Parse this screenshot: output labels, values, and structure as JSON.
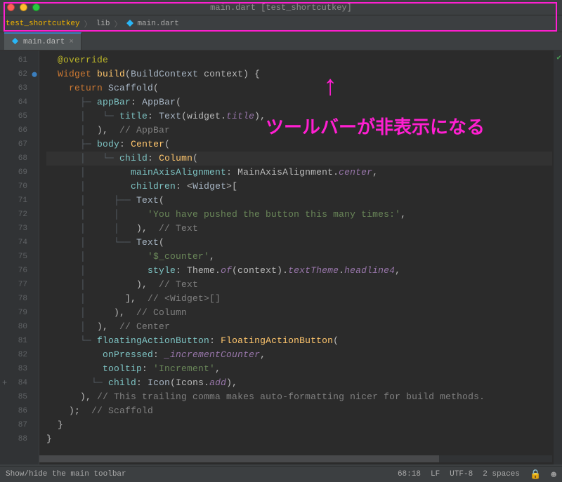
{
  "window": {
    "title": "main.dart [test_shortcutkey]"
  },
  "breadcrumbs": {
    "item0": "test_shortcutkey",
    "item1": "lib",
    "item2": "main.dart"
  },
  "tabs": {
    "active": {
      "label": "main.dart"
    }
  },
  "annotation": {
    "text": "ツールバーが非表示になる",
    "arrow": "↑"
  },
  "gutter": {
    "start": 61,
    "current": 68,
    "addMarkAt": 84
  },
  "code_lines": [
    {
      "n": 61,
      "seg": [
        [
          "  ",
          ""
        ],
        [
          "@override",
          "c-ann"
        ]
      ]
    },
    {
      "n": 62,
      "seg": [
        [
          "  ",
          ""
        ],
        [
          "Widget ",
          "c-kw"
        ],
        [
          "build",
          "c-meth"
        ],
        [
          "(",
          ""
        ],
        [
          "BuildContext",
          "c-type"
        ],
        [
          " context) {",
          ""
        ]
      ]
    },
    {
      "n": 63,
      "seg": [
        [
          "    ",
          ""
        ],
        [
          "return ",
          "c-kw"
        ],
        [
          "Scaffold",
          "c-type"
        ],
        [
          "(",
          ""
        ]
      ]
    },
    {
      "n": 64,
      "seg": [
        [
          "      ",
          ""
        ],
        [
          "├─ ",
          "tree"
        ],
        [
          "appBar",
          "c-named"
        ],
        [
          ": ",
          ""
        ],
        [
          "AppBar",
          "c-type"
        ],
        [
          "(",
          ""
        ]
      ]
    },
    {
      "n": 65,
      "seg": [
        [
          "      ",
          ""
        ],
        [
          "│   └─ ",
          "tree"
        ],
        [
          "title",
          "c-named"
        ],
        [
          ": ",
          ""
        ],
        [
          "Text",
          "c-type"
        ],
        [
          "(widget.",
          ""
        ],
        [
          "title",
          "c-id"
        ],
        [
          "),",
          ""
        ]
      ]
    },
    {
      "n": 66,
      "seg": [
        [
          "      ",
          ""
        ],
        [
          "│  ",
          "tree"
        ],
        [
          "),  ",
          ""
        ],
        [
          "// AppBar",
          "c-cmt"
        ]
      ]
    },
    {
      "n": 67,
      "seg": [
        [
          "      ",
          ""
        ],
        [
          "├─ ",
          "tree"
        ],
        [
          "body",
          "c-named"
        ],
        [
          ": ",
          ""
        ],
        [
          "Center",
          "c-coly"
        ],
        [
          "(",
          ""
        ]
      ]
    },
    {
      "n": 68,
      "current": true,
      "seg": [
        [
          "      ",
          ""
        ],
        [
          "│   └─ ",
          "tree"
        ],
        [
          "child",
          "c-named"
        ],
        [
          ": ",
          ""
        ],
        [
          "Column",
          "c-coly"
        ],
        [
          "(",
          ""
        ]
      ]
    },
    {
      "n": 69,
      "seg": [
        [
          "      ",
          ""
        ],
        [
          "│        ",
          "tree"
        ],
        [
          "mainAxisAlignment",
          "c-named"
        ],
        [
          ": MainAxisAlignment.",
          ""
        ],
        [
          "center",
          "c-id"
        ],
        [
          ",",
          ""
        ]
      ]
    },
    {
      "n": 70,
      "seg": [
        [
          "      ",
          ""
        ],
        [
          "│        ",
          "tree"
        ],
        [
          "children",
          "c-named"
        ],
        [
          ": <",
          ""
        ],
        [
          "Widget",
          "c-type"
        ],
        [
          ">[",
          ""
        ]
      ]
    },
    {
      "n": 71,
      "seg": [
        [
          "      ",
          ""
        ],
        [
          "│     ├── ",
          "tree"
        ],
        [
          "Text",
          "c-type"
        ],
        [
          "(",
          ""
        ]
      ]
    },
    {
      "n": 72,
      "seg": [
        [
          "      ",
          ""
        ],
        [
          "│     │     ",
          "tree"
        ],
        [
          "'You have pushed the button this many times:'",
          "c-str"
        ],
        [
          ",",
          ""
        ]
      ]
    },
    {
      "n": 73,
      "seg": [
        [
          "      ",
          ""
        ],
        [
          "│     │   ",
          "tree"
        ],
        [
          "),  ",
          ""
        ],
        [
          "// Text",
          "c-cmt"
        ]
      ]
    },
    {
      "n": 74,
      "seg": [
        [
          "      ",
          ""
        ],
        [
          "│     └── ",
          "tree"
        ],
        [
          "Text",
          "c-type"
        ],
        [
          "(",
          ""
        ]
      ]
    },
    {
      "n": 75,
      "seg": [
        [
          "      ",
          ""
        ],
        [
          "│           ",
          "tree"
        ],
        [
          "'$_counter'",
          "c-str"
        ],
        [
          ",",
          ""
        ]
      ]
    },
    {
      "n": 76,
      "seg": [
        [
          "      ",
          ""
        ],
        [
          "│           ",
          "tree"
        ],
        [
          "style",
          "c-named"
        ],
        [
          ": Theme.",
          ""
        ],
        [
          "of",
          "c-id"
        ],
        [
          "(context).",
          ""
        ],
        [
          "textTheme",
          "c-id"
        ],
        [
          ".",
          ""
        ],
        [
          "headline4",
          "c-id"
        ],
        [
          ",",
          ""
        ]
      ]
    },
    {
      "n": 77,
      "seg": [
        [
          "      ",
          ""
        ],
        [
          "│         ",
          "tree"
        ],
        [
          "),  ",
          ""
        ],
        [
          "// Text",
          "c-cmt"
        ]
      ]
    },
    {
      "n": 78,
      "seg": [
        [
          "      ",
          ""
        ],
        [
          "│       ",
          "tree"
        ],
        [
          "],  ",
          ""
        ],
        [
          "// <Widget>[]",
          "c-cmt"
        ]
      ]
    },
    {
      "n": 79,
      "seg": [
        [
          "      ",
          ""
        ],
        [
          "│     ",
          "tree"
        ],
        [
          "),  ",
          ""
        ],
        [
          "// Column",
          "c-cmt"
        ]
      ]
    },
    {
      "n": 80,
      "seg": [
        [
          "      ",
          ""
        ],
        [
          "│  ",
          "tree"
        ],
        [
          "),  ",
          ""
        ],
        [
          "// Center",
          "c-cmt"
        ]
      ]
    },
    {
      "n": 81,
      "seg": [
        [
          "      ",
          ""
        ],
        [
          "└─ ",
          "tree"
        ],
        [
          "floatingActionButton",
          "c-named"
        ],
        [
          ": ",
          ""
        ],
        [
          "FloatingActionButton",
          "c-coly"
        ],
        [
          "(",
          ""
        ]
      ]
    },
    {
      "n": 82,
      "seg": [
        [
          "          ",
          ""
        ],
        [
          "onPressed",
          "c-named"
        ],
        [
          ": ",
          ""
        ],
        [
          "_incrementCounter",
          "c-id"
        ],
        [
          ",",
          ""
        ]
      ]
    },
    {
      "n": 83,
      "seg": [
        [
          "          ",
          ""
        ],
        [
          "tooltip",
          "c-named"
        ],
        [
          ": ",
          ""
        ],
        [
          "'Increment'",
          "c-str"
        ],
        [
          ",",
          ""
        ]
      ]
    },
    {
      "n": 84,
      "seg": [
        [
          "        ",
          ""
        ],
        [
          "└─ ",
          "tree"
        ],
        [
          "child",
          "c-named"
        ],
        [
          ": ",
          ""
        ],
        [
          "Icon",
          "c-type"
        ],
        [
          "(Icons.",
          ""
        ],
        [
          "add",
          "c-id"
        ],
        [
          "),",
          ""
        ]
      ]
    },
    {
      "n": 85,
      "seg": [
        [
          "      ",
          ""
        ],
        [
          "), ",
          ""
        ],
        [
          "// This trailing comma makes auto-formatting nicer for build methods.",
          "c-cmt"
        ]
      ]
    },
    {
      "n": 86,
      "seg": [
        [
          "    ",
          ""
        ],
        [
          ");  ",
          ""
        ],
        [
          "// Scaffold",
          "c-cmt"
        ]
      ]
    },
    {
      "n": 87,
      "seg": [
        [
          "  }",
          ""
        ]
      ]
    },
    {
      "n": 88,
      "seg": [
        [
          "}",
          ""
        ]
      ]
    }
  ],
  "status": {
    "hint": "Show/hide the main toolbar",
    "pos": "68:18",
    "line_sep": "LF",
    "encoding": "UTF-8",
    "indent": "2 spaces"
  },
  "colors": {
    "annotation": "#ff1fd1",
    "editor_bg": "#2b2b2b",
    "chrome_bg": "#3c3f41"
  }
}
